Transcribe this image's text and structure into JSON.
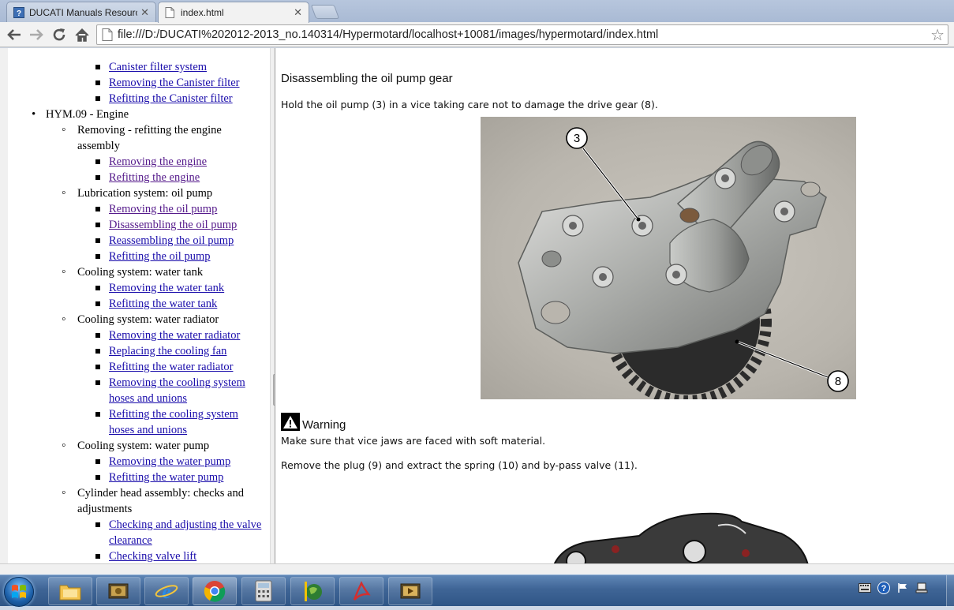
{
  "browser": {
    "tabs": [
      {
        "label": "DUCATI Manuals Resource",
        "active": false
      },
      {
        "label": "index.html",
        "active": true
      }
    ],
    "address": "file:///D:/DUCATI%202012-2013_no.140314/Hypermotard/localhost+10081/images/hypermotard/index.html",
    "icons": [
      "back-arrow",
      "forward-arrow",
      "reload",
      "home",
      "page",
      "bookmark-star"
    ]
  },
  "toc": {
    "items": [
      {
        "level": 3,
        "text": "Canister filter system",
        "link": true,
        "visited": false
      },
      {
        "level": 3,
        "text": "Removing the Canister filter",
        "link": true,
        "visited": false
      },
      {
        "level": 3,
        "text": "Refitting the Canister filter",
        "link": true,
        "visited": false
      },
      {
        "level": 1,
        "text": "HYM.09 - Engine",
        "link": false
      },
      {
        "level": 2,
        "text": "Removing - refitting the engine assembly",
        "link": false
      },
      {
        "level": 3,
        "text": "Removing the engine",
        "link": true,
        "visited": true
      },
      {
        "level": 3,
        "text": "Refitting the engine",
        "link": true,
        "visited": true
      },
      {
        "level": 2,
        "text": "Lubrication system: oil pump",
        "link": false
      },
      {
        "level": 3,
        "text": "Removing the oil pump",
        "link": true,
        "visited": true
      },
      {
        "level": 3,
        "text": "Disassembling the oil pump",
        "link": true,
        "visited": true
      },
      {
        "level": 3,
        "text": "Reassembling the oil pump",
        "link": true,
        "visited": false
      },
      {
        "level": 3,
        "text": "Refitting the oil pump",
        "link": true,
        "visited": false
      },
      {
        "level": 2,
        "text": "Cooling system: water tank",
        "link": false
      },
      {
        "level": 3,
        "text": "Removing the water tank",
        "link": true,
        "visited": false
      },
      {
        "level": 3,
        "text": "Refitting the water tank",
        "link": true,
        "visited": false
      },
      {
        "level": 2,
        "text": "Cooling system: water radiator",
        "link": false
      },
      {
        "level": 3,
        "text": "Removing the water radiator",
        "link": true,
        "visited": false
      },
      {
        "level": 3,
        "text": "Replacing the cooling fan",
        "link": true,
        "visited": false
      },
      {
        "level": 3,
        "text": "Refitting the water radiator",
        "link": true,
        "visited": false
      },
      {
        "level": 3,
        "text": "Removing the cooling system hoses and unions",
        "link": true,
        "visited": false
      },
      {
        "level": 3,
        "text": "Refitting the cooling system hoses and unions",
        "link": true,
        "visited": false
      },
      {
        "level": 2,
        "text": "Cooling system: water pump",
        "link": false
      },
      {
        "level": 3,
        "text": "Removing the water pump",
        "link": true,
        "visited": false
      },
      {
        "level": 3,
        "text": "Refitting the water pump",
        "link": true,
        "visited": false
      },
      {
        "level": 2,
        "text": "Cylinder head assembly: checks and adjustments",
        "link": false
      },
      {
        "level": 3,
        "text": "Checking and adjusting the valve clearance",
        "link": true,
        "visited": false
      },
      {
        "level": 3,
        "text": "Checking valve lift",
        "link": true,
        "visited": false
      }
    ]
  },
  "article": {
    "title": "Disassembling the oil pump gear",
    "step1": "Hold the oil pump (3) in a vice taking care not to damage the drive gear (8).",
    "callouts": [
      "3",
      "8"
    ],
    "warning_label": "Warning",
    "warning_text": "Make sure that vice jaws are faced with soft material.",
    "step2": "Remove the plug (9) and extract the spring (10) and by-pass valve (11)."
  },
  "taskbar": {
    "items": [
      "start-orb",
      "file-explorer",
      "media-center",
      "internet-explorer",
      "chrome",
      "calculator",
      "globe-pin-app",
      "pdf-reader",
      "film-app"
    ],
    "active": "chrome",
    "tray": [
      "keyboard",
      "help",
      "flag",
      "network"
    ]
  }
}
